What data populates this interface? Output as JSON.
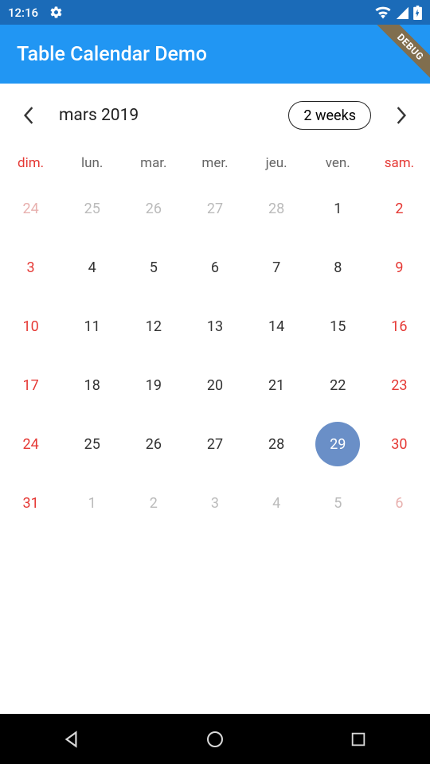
{
  "status": {
    "time": "12:16"
  },
  "app": {
    "title": "Table Calendar Demo",
    "debug": "DEBUG"
  },
  "calendar": {
    "month_label": "mars 2019",
    "weeks_label": "2 weeks",
    "dow": [
      "dim.",
      "lun.",
      "mar.",
      "mer.",
      "jeu.",
      "ven.",
      "sam."
    ],
    "rows": [
      [
        {
          "d": "24",
          "out": true,
          "we": true
        },
        {
          "d": "25",
          "out": true
        },
        {
          "d": "26",
          "out": true
        },
        {
          "d": "27",
          "out": true
        },
        {
          "d": "28",
          "out": true
        },
        {
          "d": "1"
        },
        {
          "d": "2",
          "we": true
        }
      ],
      [
        {
          "d": "3",
          "we": true
        },
        {
          "d": "4"
        },
        {
          "d": "5"
        },
        {
          "d": "6"
        },
        {
          "d": "7"
        },
        {
          "d": "8"
        },
        {
          "d": "9",
          "we": true
        }
      ],
      [
        {
          "d": "10",
          "we": true
        },
        {
          "d": "11"
        },
        {
          "d": "12"
        },
        {
          "d": "13"
        },
        {
          "d": "14"
        },
        {
          "d": "15"
        },
        {
          "d": "16",
          "we": true
        }
      ],
      [
        {
          "d": "17",
          "we": true
        },
        {
          "d": "18"
        },
        {
          "d": "19"
        },
        {
          "d": "20"
        },
        {
          "d": "21"
        },
        {
          "d": "22"
        },
        {
          "d": "23",
          "we": true
        }
      ],
      [
        {
          "d": "24",
          "we": true
        },
        {
          "d": "25"
        },
        {
          "d": "26"
        },
        {
          "d": "27"
        },
        {
          "d": "28"
        },
        {
          "d": "29",
          "today": true
        },
        {
          "d": "30",
          "we": true
        }
      ],
      [
        {
          "d": "31",
          "we": true
        },
        {
          "d": "1",
          "out": true
        },
        {
          "d": "2",
          "out": true
        },
        {
          "d": "3",
          "out": true
        },
        {
          "d": "4",
          "out": true
        },
        {
          "d": "5",
          "out": true
        },
        {
          "d": "6",
          "out": true,
          "we": true
        }
      ]
    ]
  }
}
